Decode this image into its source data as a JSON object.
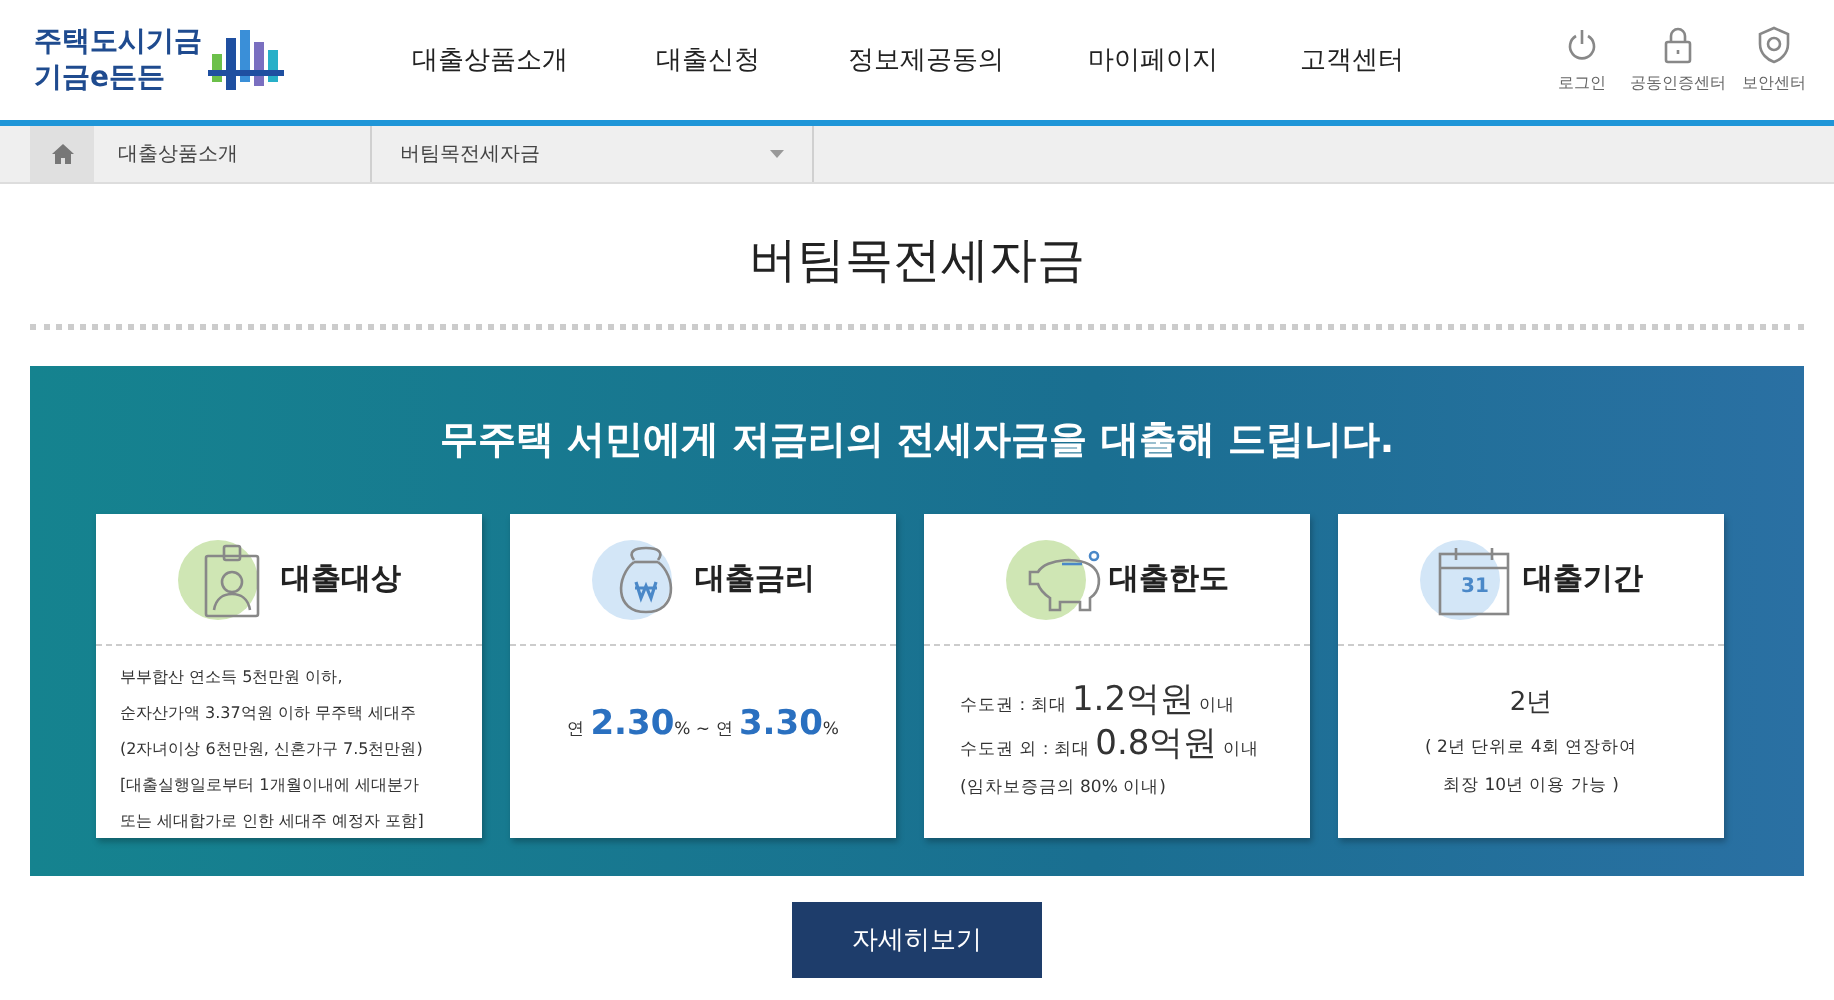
{
  "logo": {
    "line_1": "주택도시기금",
    "line_2": "기금e든든"
  },
  "nav": [
    "대출상품소개",
    "대출신청",
    "정보제공동의",
    "마이페이지",
    "고객센터"
  ],
  "utilities": [
    {
      "kind": "power",
      "label": "로그인"
    },
    {
      "kind": "lock",
      "label": "공동인증센터"
    },
    {
      "kind": "shield",
      "label": "보안센터"
    }
  ],
  "breadcrumb": {
    "section": "대출상품소개",
    "current": "버팀목전세자금"
  },
  "page_title": "버팀목전세자금",
  "banner": {
    "headline": "무주택 서민에게 저금리의 전세자금을 대출해 드립니다.",
    "cards": [
      {
        "kind": "badge",
        "color": "#cfe6b4",
        "title": "대출대상",
        "lines": [
          [
            {
              "kind": "small",
              "text": "부부합산 연소득 5천만원 이하,"
            }
          ],
          [
            {
              "kind": "small",
              "text": "순자산가액 3.37억원 이하 무주택 세대주"
            }
          ],
          [
            {
              "kind": "small",
              "text": "(2자녀이상 6천만원, 신혼가구 7.5천만원)"
            }
          ],
          [
            {
              "kind": "small",
              "text": "[대출실행일로부터 1개월이내에 세대분가"
            }
          ],
          [
            {
              "kind": "small",
              "text": "또는 세대합가로 인한 세대주 예정자 포함]"
            }
          ]
        ]
      },
      {
        "kind": "moneybag",
        "color": "#d3e6f7",
        "title": "대출금리",
        "lines": [
          [
            {
              "kind": "small",
              "text": "연 "
            },
            {
              "kind": "accent",
              "text": "2.30"
            },
            {
              "kind": "small",
              "text": "% ~ 연 "
            },
            {
              "kind": "accent",
              "text": "3.30"
            },
            {
              "kind": "small",
              "text": "%"
            }
          ]
        ]
      },
      {
        "kind": "piggy",
        "color": "#cfe6b4",
        "title": "대출한도",
        "lines": [
          [
            {
              "kind": "small",
              "text": "수도권 : 최대 "
            },
            {
              "kind": "large",
              "text": "1.2억원"
            },
            {
              "kind": "small",
              "text": " 이내"
            }
          ],
          [
            {
              "kind": "small",
              "text": "수도권 외 : 최대 "
            },
            {
              "kind": "large",
              "text": "0.8억원"
            },
            {
              "kind": "small",
              "text": " 이내"
            }
          ],
          [
            {
              "kind": "small",
              "text": "(임차보증금의 80% 이내)"
            }
          ]
        ]
      },
      {
        "kind": "calendar",
        "color": "#d3e6f7",
        "title": "대출기간",
        "lines": [
          [
            {
              "kind": "medium",
              "text": "2년"
            }
          ],
          [
            {
              "kind": "small",
              "text": "( 2년 단위로 4회 연장하여"
            }
          ],
          [
            {
              "kind": "small",
              "text": "최장 10년 이용 가능 )"
            }
          ]
        ],
        "calendar_day": "31"
      }
    ]
  },
  "more_button": "자세히보기"
}
